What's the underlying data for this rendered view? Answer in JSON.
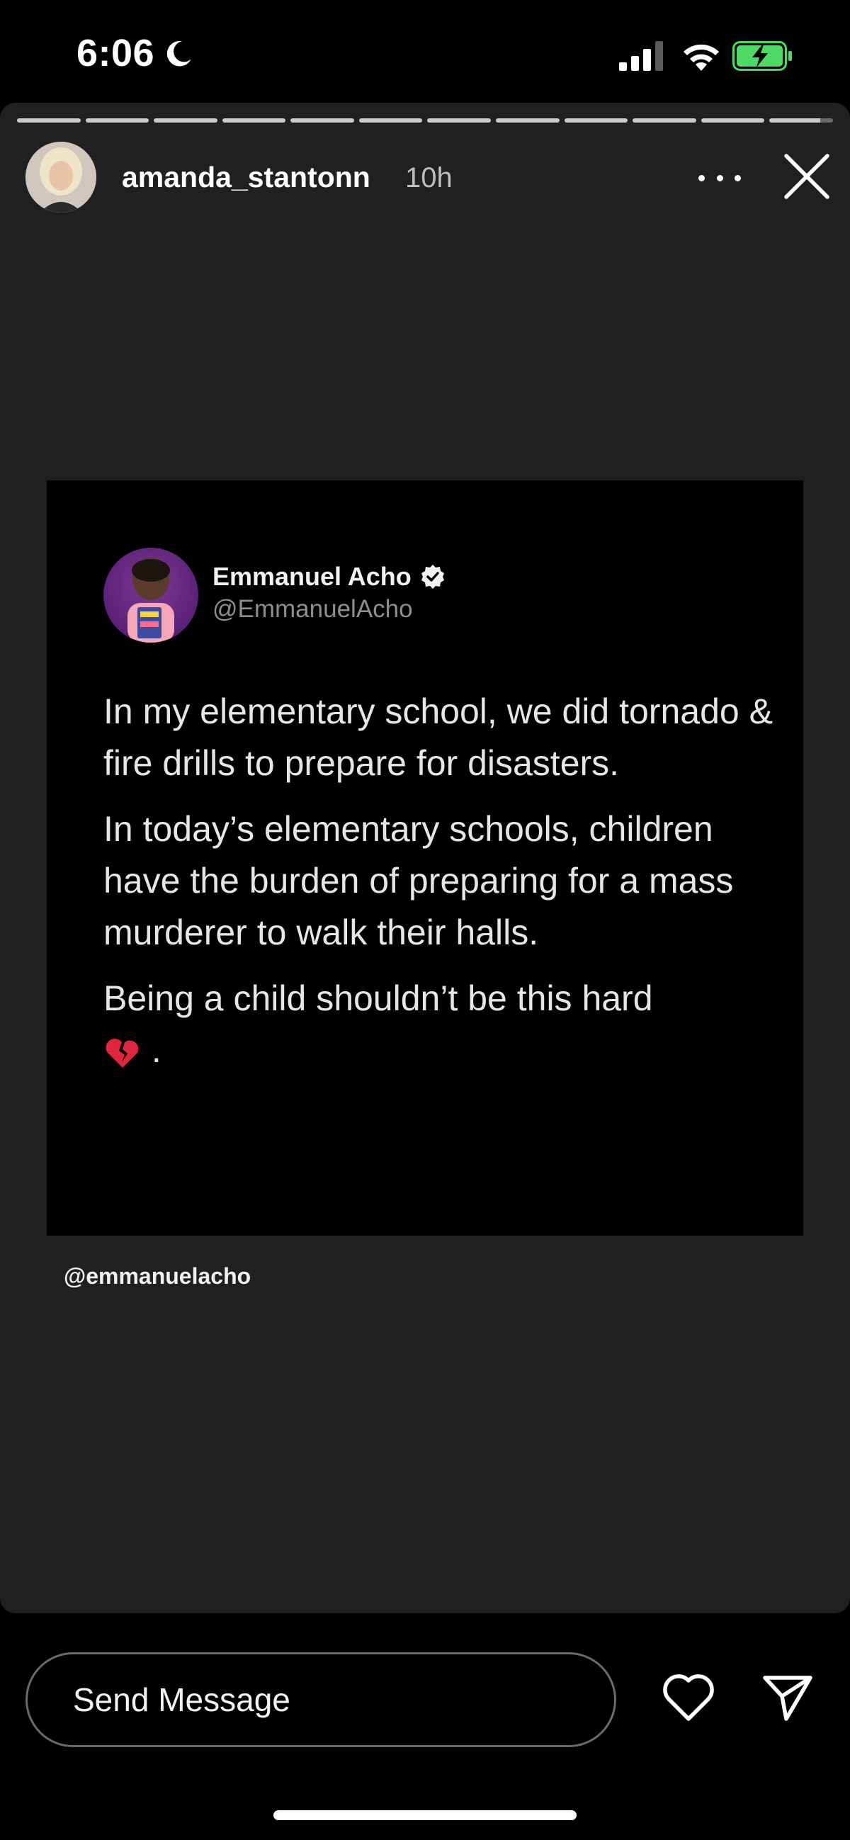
{
  "status_bar": {
    "time": "6:06"
  },
  "story": {
    "progress_segments": 12,
    "username": "amanda_stantonn",
    "time_ago": "10h",
    "mention": "@emmanuelacho",
    "tweet": {
      "author_name": "Emmanuel Acho",
      "author_handle": "@EmmanuelAcho",
      "paragraphs": [
        "In my elementary school, we did tornado & fire drills to prepare for disasters.",
        "In today’s elementary schools, children have the burden of preparing for a mass murderer to walk their halls.",
        "Being a child shouldn’t be this hard"
      ],
      "trailing_text": "."
    }
  },
  "bottom_bar": {
    "message_placeholder": "Send Message"
  },
  "colors": {
    "background": "#000000",
    "story_bg": "#202020",
    "battery_green": "#4cd964"
  },
  "icons": [
    "moon-icon",
    "signal-icon",
    "wifi-icon",
    "battery-charging-icon",
    "more-icon",
    "close-icon",
    "verified-icon",
    "broken-heart-icon",
    "heart-icon",
    "send-icon"
  ]
}
